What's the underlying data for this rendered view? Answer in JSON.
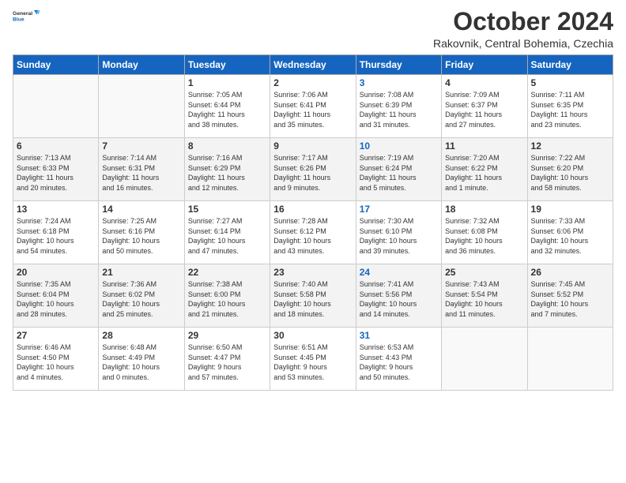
{
  "logo": {
    "general": "General",
    "blue": "Blue"
  },
  "header": {
    "month": "October 2024",
    "location": "Rakovnik, Central Bohemia, Czechia"
  },
  "days_of_week": [
    "Sunday",
    "Monday",
    "Tuesday",
    "Wednesday",
    "Thursday",
    "Friday",
    "Saturday"
  ],
  "weeks": [
    [
      {
        "day": "",
        "details": ""
      },
      {
        "day": "",
        "details": ""
      },
      {
        "day": "1",
        "details": "Sunrise: 7:05 AM\nSunset: 6:44 PM\nDaylight: 11 hours\nand 38 minutes."
      },
      {
        "day": "2",
        "details": "Sunrise: 7:06 AM\nSunset: 6:41 PM\nDaylight: 11 hours\nand 35 minutes."
      },
      {
        "day": "3",
        "details": "Sunrise: 7:08 AM\nSunset: 6:39 PM\nDaylight: 11 hours\nand 31 minutes."
      },
      {
        "day": "4",
        "details": "Sunrise: 7:09 AM\nSunset: 6:37 PM\nDaylight: 11 hours\nand 27 minutes."
      },
      {
        "day": "5",
        "details": "Sunrise: 7:11 AM\nSunset: 6:35 PM\nDaylight: 11 hours\nand 23 minutes."
      }
    ],
    [
      {
        "day": "6",
        "details": "Sunrise: 7:13 AM\nSunset: 6:33 PM\nDaylight: 11 hours\nand 20 minutes."
      },
      {
        "day": "7",
        "details": "Sunrise: 7:14 AM\nSunset: 6:31 PM\nDaylight: 11 hours\nand 16 minutes."
      },
      {
        "day": "8",
        "details": "Sunrise: 7:16 AM\nSunset: 6:29 PM\nDaylight: 11 hours\nand 12 minutes."
      },
      {
        "day": "9",
        "details": "Sunrise: 7:17 AM\nSunset: 6:26 PM\nDaylight: 11 hours\nand 9 minutes."
      },
      {
        "day": "10",
        "details": "Sunrise: 7:19 AM\nSunset: 6:24 PM\nDaylight: 11 hours\nand 5 minutes."
      },
      {
        "day": "11",
        "details": "Sunrise: 7:20 AM\nSunset: 6:22 PM\nDaylight: 11 hours\nand 1 minute."
      },
      {
        "day": "12",
        "details": "Sunrise: 7:22 AM\nSunset: 6:20 PM\nDaylight: 10 hours\nand 58 minutes."
      }
    ],
    [
      {
        "day": "13",
        "details": "Sunrise: 7:24 AM\nSunset: 6:18 PM\nDaylight: 10 hours\nand 54 minutes."
      },
      {
        "day": "14",
        "details": "Sunrise: 7:25 AM\nSunset: 6:16 PM\nDaylight: 10 hours\nand 50 minutes."
      },
      {
        "day": "15",
        "details": "Sunrise: 7:27 AM\nSunset: 6:14 PM\nDaylight: 10 hours\nand 47 minutes."
      },
      {
        "day": "16",
        "details": "Sunrise: 7:28 AM\nSunset: 6:12 PM\nDaylight: 10 hours\nand 43 minutes."
      },
      {
        "day": "17",
        "details": "Sunrise: 7:30 AM\nSunset: 6:10 PM\nDaylight: 10 hours\nand 39 minutes."
      },
      {
        "day": "18",
        "details": "Sunrise: 7:32 AM\nSunset: 6:08 PM\nDaylight: 10 hours\nand 36 minutes."
      },
      {
        "day": "19",
        "details": "Sunrise: 7:33 AM\nSunset: 6:06 PM\nDaylight: 10 hours\nand 32 minutes."
      }
    ],
    [
      {
        "day": "20",
        "details": "Sunrise: 7:35 AM\nSunset: 6:04 PM\nDaylight: 10 hours\nand 28 minutes."
      },
      {
        "day": "21",
        "details": "Sunrise: 7:36 AM\nSunset: 6:02 PM\nDaylight: 10 hours\nand 25 minutes."
      },
      {
        "day": "22",
        "details": "Sunrise: 7:38 AM\nSunset: 6:00 PM\nDaylight: 10 hours\nand 21 minutes."
      },
      {
        "day": "23",
        "details": "Sunrise: 7:40 AM\nSunset: 5:58 PM\nDaylight: 10 hours\nand 18 minutes."
      },
      {
        "day": "24",
        "details": "Sunrise: 7:41 AM\nSunset: 5:56 PM\nDaylight: 10 hours\nand 14 minutes."
      },
      {
        "day": "25",
        "details": "Sunrise: 7:43 AM\nSunset: 5:54 PM\nDaylight: 10 hours\nand 11 minutes."
      },
      {
        "day": "26",
        "details": "Sunrise: 7:45 AM\nSunset: 5:52 PM\nDaylight: 10 hours\nand 7 minutes."
      }
    ],
    [
      {
        "day": "27",
        "details": "Sunrise: 6:46 AM\nSunset: 4:50 PM\nDaylight: 10 hours\nand 4 minutes."
      },
      {
        "day": "28",
        "details": "Sunrise: 6:48 AM\nSunset: 4:49 PM\nDaylight: 10 hours\nand 0 minutes."
      },
      {
        "day": "29",
        "details": "Sunrise: 6:50 AM\nSunset: 4:47 PM\nDaylight: 9 hours\nand 57 minutes."
      },
      {
        "day": "30",
        "details": "Sunrise: 6:51 AM\nSunset: 4:45 PM\nDaylight: 9 hours\nand 53 minutes."
      },
      {
        "day": "31",
        "details": "Sunrise: 6:53 AM\nSunset: 4:43 PM\nDaylight: 9 hours\nand 50 minutes."
      },
      {
        "day": "",
        "details": ""
      },
      {
        "day": "",
        "details": ""
      }
    ]
  ]
}
